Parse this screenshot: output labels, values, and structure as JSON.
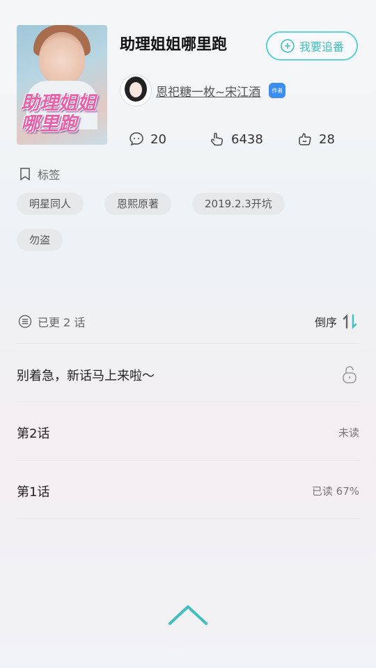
{
  "book": {
    "title": "助理姐姐哪里跑",
    "cover_text": "助理姐姐哪里跑",
    "follow_label": "我要追番",
    "author": "恩祀糖一枚~宋江酒",
    "author_badge": "作者"
  },
  "stats": {
    "comments": "20",
    "likes": "6438",
    "tips": "28"
  },
  "tags": {
    "label": "标签",
    "items": [
      "明星同人",
      "恩熙原著",
      "2019.2.3开坑",
      "勿盗"
    ]
  },
  "chapters": {
    "count_text": "已更 2 话",
    "sort_label": "倒序",
    "items": [
      {
        "title": "别着急，新话马上来啦～",
        "status": ""
      },
      {
        "title": "第2话",
        "status": "未读"
      },
      {
        "title": "第1话",
        "status": "已读 67%"
      }
    ]
  },
  "colors": {
    "accent": "#3fbfc0",
    "badge": "#3b8df2"
  },
  "icons": [
    "add-circle-icon",
    "comment-icon",
    "like-icon",
    "tip-icon",
    "tag-icon",
    "list-icon",
    "sort-icon",
    "lock-icon",
    "chevron-up-icon"
  ]
}
